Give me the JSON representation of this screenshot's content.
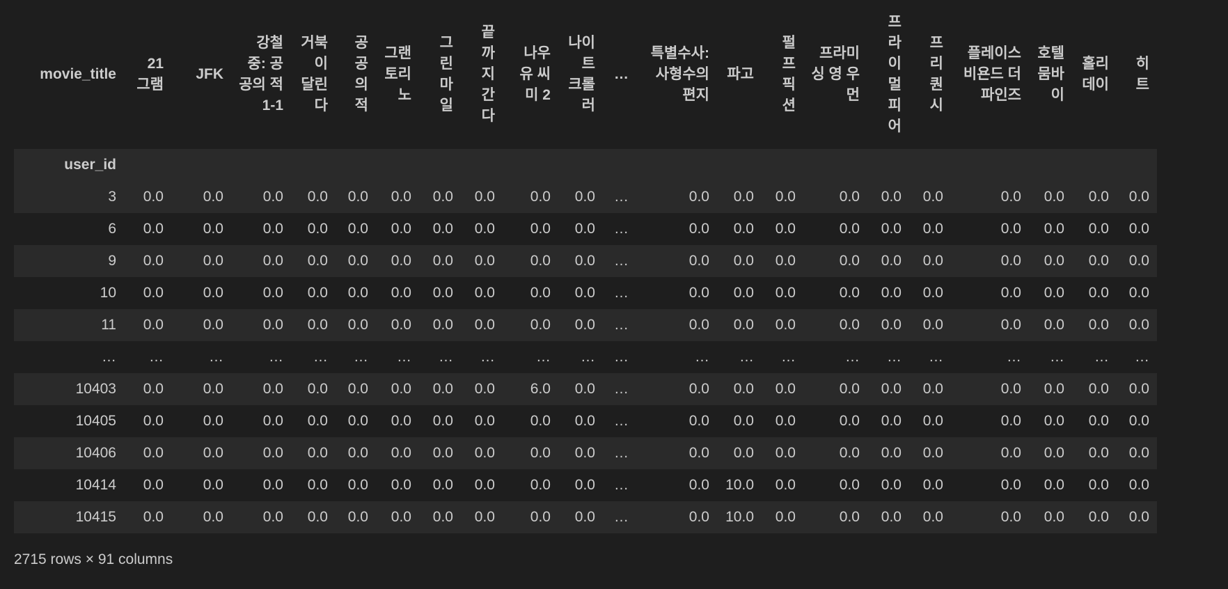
{
  "table": {
    "columns_name": "movie_title",
    "index_name": "user_id",
    "columns": [
      "21 그램",
      "JFK",
      "강철중: 공공의 적 1-1",
      "거북이 달린다",
      "공공의 적",
      "그랜토리노",
      "그린마일",
      "끝까지 간다",
      "나우 유 씨 미 2",
      "나이트 크롤러",
      "…",
      "특별수사: 사형수의 편지",
      "파고",
      "펄프 픽션",
      "프라미싱 영 우먼",
      "프라이멀 피어",
      "프리퀀시",
      "플레이스 비욘드 더 파인즈",
      "호텔 뭄바이",
      "홀리데이",
      "히트"
    ],
    "rows": [
      {
        "index": "3",
        "cells": [
          "0.0",
          "0.0",
          "0.0",
          "0.0",
          "0.0",
          "0.0",
          "0.0",
          "0.0",
          "0.0",
          "0.0",
          "…",
          "0.0",
          "0.0",
          "0.0",
          "0.0",
          "0.0",
          "0.0",
          "0.0",
          "0.0",
          "0.0",
          "0.0"
        ]
      },
      {
        "index": "6",
        "cells": [
          "0.0",
          "0.0",
          "0.0",
          "0.0",
          "0.0",
          "0.0",
          "0.0",
          "0.0",
          "0.0",
          "0.0",
          "…",
          "0.0",
          "0.0",
          "0.0",
          "0.0",
          "0.0",
          "0.0",
          "0.0",
          "0.0",
          "0.0",
          "0.0"
        ]
      },
      {
        "index": "9",
        "cells": [
          "0.0",
          "0.0",
          "0.0",
          "0.0",
          "0.0",
          "0.0",
          "0.0",
          "0.0",
          "0.0",
          "0.0",
          "…",
          "0.0",
          "0.0",
          "0.0",
          "0.0",
          "0.0",
          "0.0",
          "0.0",
          "0.0",
          "0.0",
          "0.0"
        ]
      },
      {
        "index": "10",
        "cells": [
          "0.0",
          "0.0",
          "0.0",
          "0.0",
          "0.0",
          "0.0",
          "0.0",
          "0.0",
          "0.0",
          "0.0",
          "…",
          "0.0",
          "0.0",
          "0.0",
          "0.0",
          "0.0",
          "0.0",
          "0.0",
          "0.0",
          "0.0",
          "0.0"
        ]
      },
      {
        "index": "11",
        "cells": [
          "0.0",
          "0.0",
          "0.0",
          "0.0",
          "0.0",
          "0.0",
          "0.0",
          "0.0",
          "0.0",
          "0.0",
          "…",
          "0.0",
          "0.0",
          "0.0",
          "0.0",
          "0.0",
          "0.0",
          "0.0",
          "0.0",
          "0.0",
          "0.0"
        ]
      },
      {
        "index": "…",
        "cells": [
          "…",
          "…",
          "…",
          "…",
          "…",
          "…",
          "…",
          "…",
          "…",
          "…",
          "…",
          "…",
          "…",
          "…",
          "…",
          "…",
          "…",
          "…",
          "…",
          "…",
          "…"
        ]
      },
      {
        "index": "10403",
        "cells": [
          "0.0",
          "0.0",
          "0.0",
          "0.0",
          "0.0",
          "0.0",
          "0.0",
          "0.0",
          "6.0",
          "0.0",
          "…",
          "0.0",
          "0.0",
          "0.0",
          "0.0",
          "0.0",
          "0.0",
          "0.0",
          "0.0",
          "0.0",
          "0.0"
        ]
      },
      {
        "index": "10405",
        "cells": [
          "0.0",
          "0.0",
          "0.0",
          "0.0",
          "0.0",
          "0.0",
          "0.0",
          "0.0",
          "0.0",
          "0.0",
          "…",
          "0.0",
          "0.0",
          "0.0",
          "0.0",
          "0.0",
          "0.0",
          "0.0",
          "0.0",
          "0.0",
          "0.0"
        ]
      },
      {
        "index": "10406",
        "cells": [
          "0.0",
          "0.0",
          "0.0",
          "0.0",
          "0.0",
          "0.0",
          "0.0",
          "0.0",
          "0.0",
          "0.0",
          "…",
          "0.0",
          "0.0",
          "0.0",
          "0.0",
          "0.0",
          "0.0",
          "0.0",
          "0.0",
          "0.0",
          "0.0"
        ]
      },
      {
        "index": "10414",
        "cells": [
          "0.0",
          "0.0",
          "0.0",
          "0.0",
          "0.0",
          "0.0",
          "0.0",
          "0.0",
          "0.0",
          "0.0",
          "…",
          "0.0",
          "10.0",
          "0.0",
          "0.0",
          "0.0",
          "0.0",
          "0.0",
          "0.0",
          "0.0",
          "0.0"
        ]
      },
      {
        "index": "10415",
        "cells": [
          "0.0",
          "0.0",
          "0.0",
          "0.0",
          "0.0",
          "0.0",
          "0.0",
          "0.0",
          "0.0",
          "0.0",
          "…",
          "0.0",
          "10.0",
          "0.0",
          "0.0",
          "0.0",
          "0.0",
          "0.0",
          "0.0",
          "0.0",
          "0.0"
        ]
      }
    ]
  },
  "shape_caption": "2715 rows × 91 columns"
}
